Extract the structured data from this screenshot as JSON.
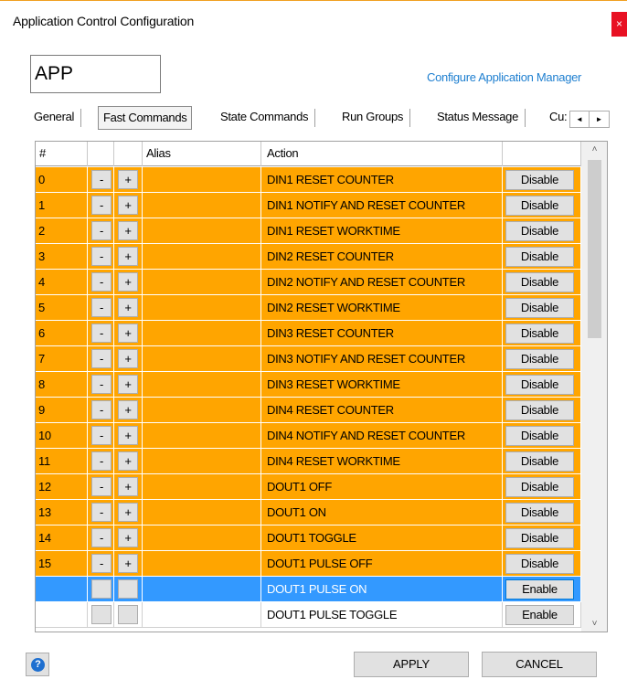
{
  "window": {
    "title": "Application Control Configuration",
    "close_label": "×"
  },
  "app_name": "APP",
  "configure_link": "Configure Application Manager",
  "tabs": [
    {
      "label": "General"
    },
    {
      "label": "Fast Commands",
      "active": true
    },
    {
      "label": "State Commands"
    },
    {
      "label": "Run Groups"
    },
    {
      "label": "Status Message"
    },
    {
      "label": "Cu:"
    }
  ],
  "tab_scroll": {
    "left": "◄",
    "right": "►"
  },
  "grid": {
    "columns": {
      "num": "#",
      "minus": "",
      "plus": "",
      "alias": "Alias",
      "action": "Action",
      "button": ""
    },
    "minus_label": "-",
    "plus_label": "+",
    "rows": [
      {
        "num": "0",
        "alias": "",
        "action": "DIN1 RESET COUNTER",
        "button": "Disable",
        "state": "orange"
      },
      {
        "num": "1",
        "alias": "",
        "action": "DIN1 NOTIFY AND RESET COUNTER",
        "button": "Disable",
        "state": "orange"
      },
      {
        "num": "2",
        "alias": "",
        "action": "DIN1 RESET WORKTIME",
        "button": "Disable",
        "state": "orange"
      },
      {
        "num": "3",
        "alias": "",
        "action": "DIN2 RESET COUNTER",
        "button": "Disable",
        "state": "orange"
      },
      {
        "num": "4",
        "alias": "",
        "action": "DIN2 NOTIFY AND RESET COUNTER",
        "button": "Disable",
        "state": "orange"
      },
      {
        "num": "5",
        "alias": "",
        "action": "DIN2 RESET WORKTIME",
        "button": "Disable",
        "state": "orange"
      },
      {
        "num": "6",
        "alias": "",
        "action": "DIN3 RESET COUNTER",
        "button": "Disable",
        "state": "orange"
      },
      {
        "num": "7",
        "alias": "",
        "action": "DIN3 NOTIFY AND RESET COUNTER",
        "button": "Disable",
        "state": "orange"
      },
      {
        "num": "8",
        "alias": "",
        "action": "DIN3 RESET WORKTIME",
        "button": "Disable",
        "state": "orange"
      },
      {
        "num": "9",
        "alias": "",
        "action": "DIN4 RESET COUNTER",
        "button": "Disable",
        "state": "orange"
      },
      {
        "num": "10",
        "alias": "",
        "action": "DIN4 NOTIFY AND RESET COUNTER",
        "button": "Disable",
        "state": "orange"
      },
      {
        "num": "11",
        "alias": "",
        "action": "DIN4 RESET WORKTIME",
        "button": "Disable",
        "state": "orange"
      },
      {
        "num": "12",
        "alias": "",
        "action": "DOUT1 OFF",
        "button": "Disable",
        "state": "orange"
      },
      {
        "num": "13",
        "alias": "",
        "action": "DOUT1 ON",
        "button": "Disable",
        "state": "orange"
      },
      {
        "num": "14",
        "alias": "",
        "action": "DOUT1 TOGGLE",
        "button": "Disable",
        "state": "orange"
      },
      {
        "num": "15",
        "alias": "",
        "action": "DOUT1 PULSE OFF",
        "button": "Disable",
        "state": "orange"
      },
      {
        "num": "",
        "alias": "",
        "action": "DOUT1 PULSE ON",
        "button": "Enable",
        "state": "selected"
      },
      {
        "num": "",
        "alias": "",
        "action": "DOUT1 PULSE TOGGLE",
        "button": "Enable",
        "state": "plain"
      }
    ]
  },
  "scrollbar": {
    "up": "˄",
    "down": "˅"
  },
  "footer": {
    "help_icon": "?",
    "apply": "APPLY",
    "cancel": "CANCEL"
  },
  "colors": {
    "active_row": "#ffa500",
    "selected_row": "#3399ff",
    "link": "#1e7fd0",
    "close": "#e81123"
  }
}
